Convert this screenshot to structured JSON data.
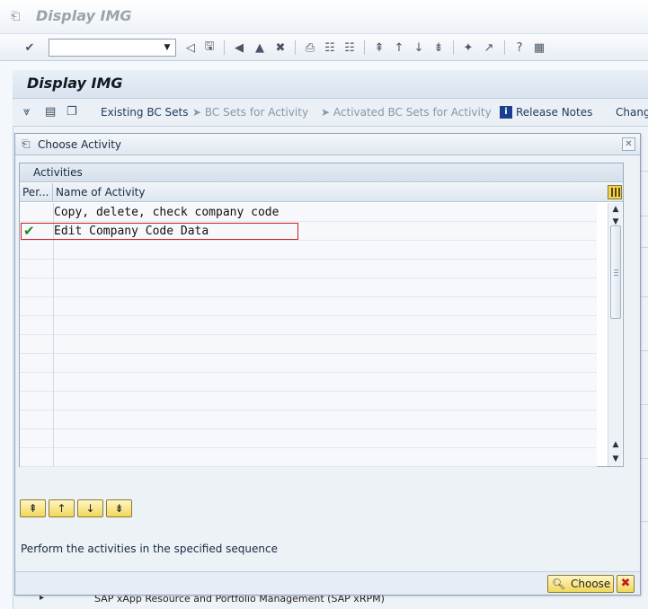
{
  "window": {
    "title": "Display IMG"
  },
  "system_toolbar": {
    "command_field_value": ""
  },
  "main": {
    "header": "Display IMG",
    "toolbar": {
      "existing_bc_sets": "Existing BC Sets",
      "bc_sets_for_activity": "BC Sets for Activity",
      "activated_bc_sets": "Activated BC Sets for Activity",
      "release_notes": "Release Notes",
      "change_truncated": "Change"
    },
    "background_tree_item": "SAP xApp Resource and Portfolio Management (SAP xRPM)"
  },
  "dialog": {
    "title": "Choose Activity",
    "table": {
      "caption": "Activities",
      "columns": [
        "Per...",
        "Name of Activity"
      ],
      "rows": [
        {
          "status": "",
          "name": "Copy, delete, check company code"
        },
        {
          "status": "check-icon",
          "name": "Edit Company Code Data"
        },
        {
          "status": "",
          "name": ""
        },
        {
          "status": "",
          "name": ""
        },
        {
          "status": "",
          "name": ""
        },
        {
          "status": "",
          "name": ""
        },
        {
          "status": "",
          "name": ""
        },
        {
          "status": "",
          "name": ""
        },
        {
          "status": "",
          "name": ""
        },
        {
          "status": "",
          "name": ""
        },
        {
          "status": "",
          "name": ""
        },
        {
          "status": "",
          "name": ""
        },
        {
          "status": "",
          "name": ""
        },
        {
          "status": "",
          "name": ""
        }
      ],
      "selected_row_index": 1
    },
    "hint": "Perform the activities in the specified sequence",
    "choose_label": "Choose"
  },
  "colors": {
    "selection_outline": "#d22020",
    "button_yellow": "#f1d75a",
    "check_green": "#1c8a1c"
  }
}
